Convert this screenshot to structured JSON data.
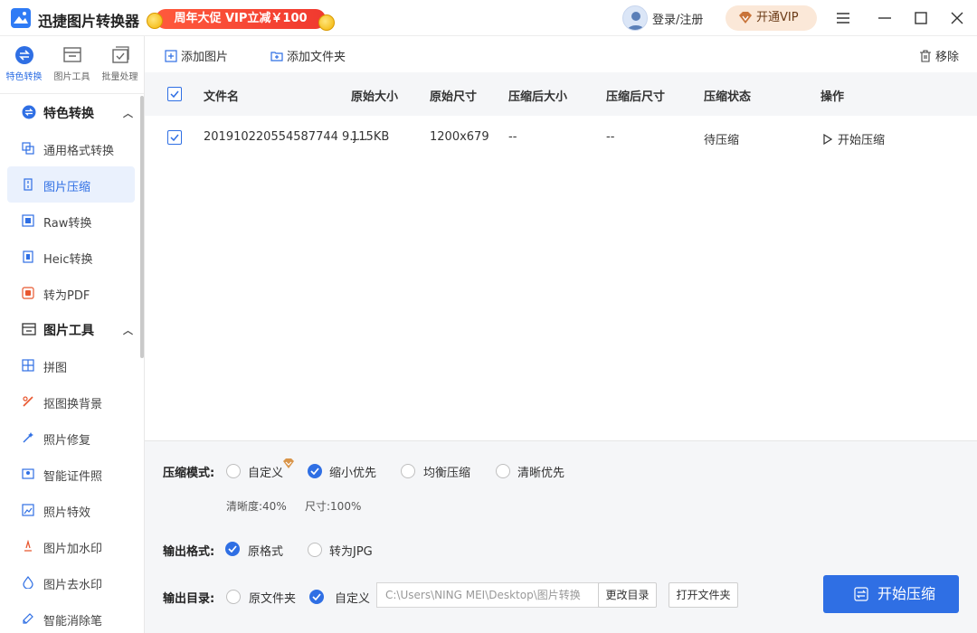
{
  "app": {
    "title": "迅捷图片转换器",
    "promo": "周年大促 VIP立减￥100",
    "login": "登录/注册",
    "vip": "开通VIP",
    "accent": "#2f6fe4"
  },
  "sidebar": {
    "tabs": [
      {
        "label": "特色转换",
        "icon": "swap-icon"
      },
      {
        "label": "图片工具",
        "icon": "image-tool-icon"
      },
      {
        "label": "批量处理",
        "icon": "batch-icon"
      }
    ],
    "groups": [
      {
        "title": "特色转换",
        "items": [
          "通用格式转换",
          "图片压缩",
          "Raw转换",
          "Heic转换",
          "转为PDF"
        ]
      },
      {
        "title": "图片工具",
        "items": [
          "拼图",
          "抠图换背景",
          "照片修复",
          "智能证件照",
          "照片特效",
          "图片加水印",
          "图片去水印",
          "智能消除笔"
        ]
      }
    ]
  },
  "toolbar": {
    "add_image": "添加图片",
    "add_folder": "添加文件夹",
    "remove": "移除"
  },
  "table": {
    "headers": [
      "文件名",
      "原始大小",
      "原始尺寸",
      "压缩后大小",
      "压缩后尺寸",
      "压缩状态",
      "操作"
    ],
    "rows": [
      {
        "filename": "201910220554587744 9.j...",
        "size": "115KB",
        "dimensions": "1200x679",
        "compressed_size": "--",
        "compressed_dimensions": "--",
        "status": "待压缩",
        "action": "开始压缩"
      }
    ]
  },
  "settings": {
    "mode_label": "压缩模式:",
    "modes": [
      "自定义",
      "缩小优先",
      "均衡压缩",
      "清晰优先"
    ],
    "clarity": "清晰度:40%",
    "size": "尺寸:100%",
    "format_label": "输出格式:",
    "formats": [
      "原格式",
      "转为JPG"
    ],
    "dir_label": "输出目录:",
    "dirs": [
      "原文件夹",
      "自定义"
    ],
    "path": "C:\\Users\\NING MEI\\Desktop\\图片转换",
    "change_dir": "更改目录",
    "open_folder": "打开文件夹",
    "start": "开始压缩"
  }
}
